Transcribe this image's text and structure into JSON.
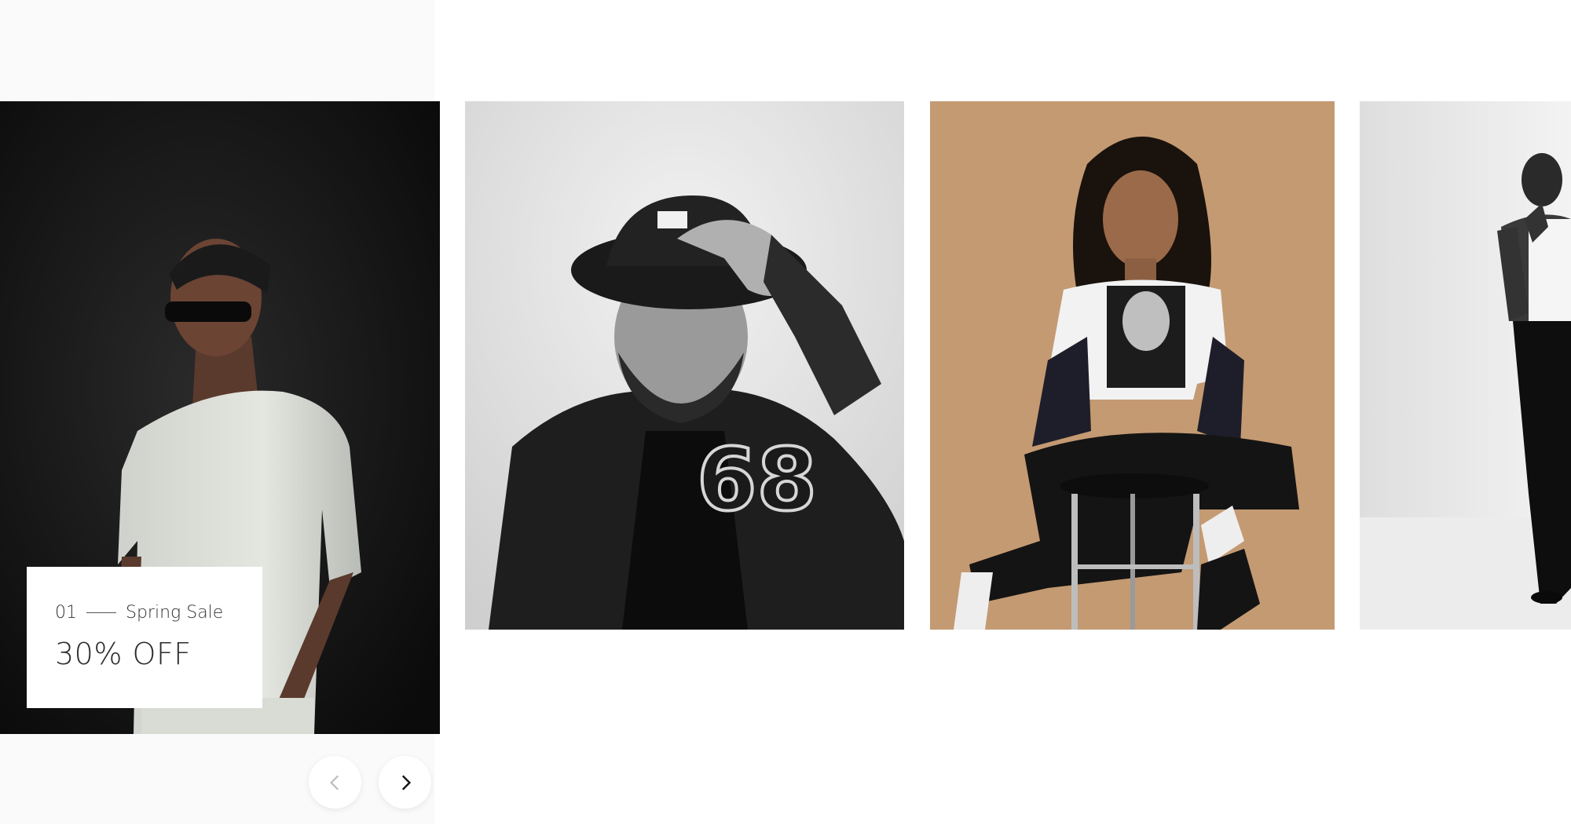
{
  "carousel": {
    "slides": [
      {
        "index_label": "01",
        "subtitle": "Spring Sale",
        "title": "30% OFF",
        "image": "man-white-tshirt-sunglasses-black-background"
      },
      {
        "image": "bearded-man-bucket-hat-68-jacket-bw"
      },
      {
        "image": "woman-graphic-tee-on-bar-stool-tan-background"
      },
      {
        "image": "man-white-tank-black-trousers-bw"
      }
    ],
    "controls": {
      "prev_icon": "chevron-left-icon",
      "next_icon": "chevron-right-icon"
    }
  },
  "colors": {
    "promo_text": "#2b2b2b",
    "nav_disabled": "#bbbbbb",
    "nav_active": "#111111",
    "slide3_background": "#c49a72"
  }
}
